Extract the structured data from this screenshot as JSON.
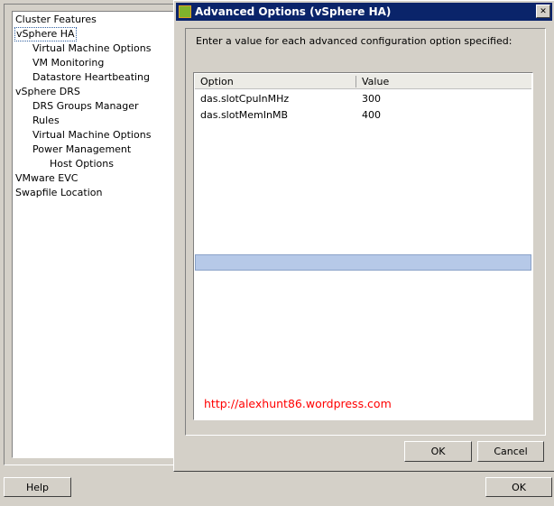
{
  "tree": [
    {
      "label": "Cluster Features",
      "level": 0
    },
    {
      "label": "vSphere HA",
      "level": 0,
      "selected": true
    },
    {
      "label": "Virtual Machine Options",
      "level": 1
    },
    {
      "label": "VM Monitoring",
      "level": 1
    },
    {
      "label": "Datastore Heartbeating",
      "level": 1
    },
    {
      "label": "vSphere DRS",
      "level": 0
    },
    {
      "label": "DRS Groups Manager",
      "level": 1
    },
    {
      "label": "Rules",
      "level": 1
    },
    {
      "label": "Virtual Machine Options",
      "level": 1
    },
    {
      "label": "Power Management",
      "level": 1
    },
    {
      "label": "Host Options",
      "level": 2
    },
    {
      "label": "VMware EVC",
      "level": 0
    },
    {
      "label": "Swapfile Location",
      "level": 0
    }
  ],
  "main": {
    "help_label": "Help",
    "ok_label": "OK"
  },
  "dialog": {
    "title": "Advanced Options (vSphere HA)",
    "close_label": "✕",
    "instruction": "Enter a value for each advanced configuration option specified:",
    "columns": [
      "Option",
      "Value"
    ],
    "rows": [
      [
        "das.slotCpuInMHz",
        "300"
      ],
      [
        "das.slotMemInMB",
        "400"
      ]
    ],
    "watermark": "http://alexhunt86.wordpress.com",
    "ok_label": "OK",
    "cancel_label": "Cancel"
  },
  "colors": {
    "titlebar": "#0a246a",
    "selected_row": "#b6c9e8",
    "watermark": "#ff0000"
  }
}
